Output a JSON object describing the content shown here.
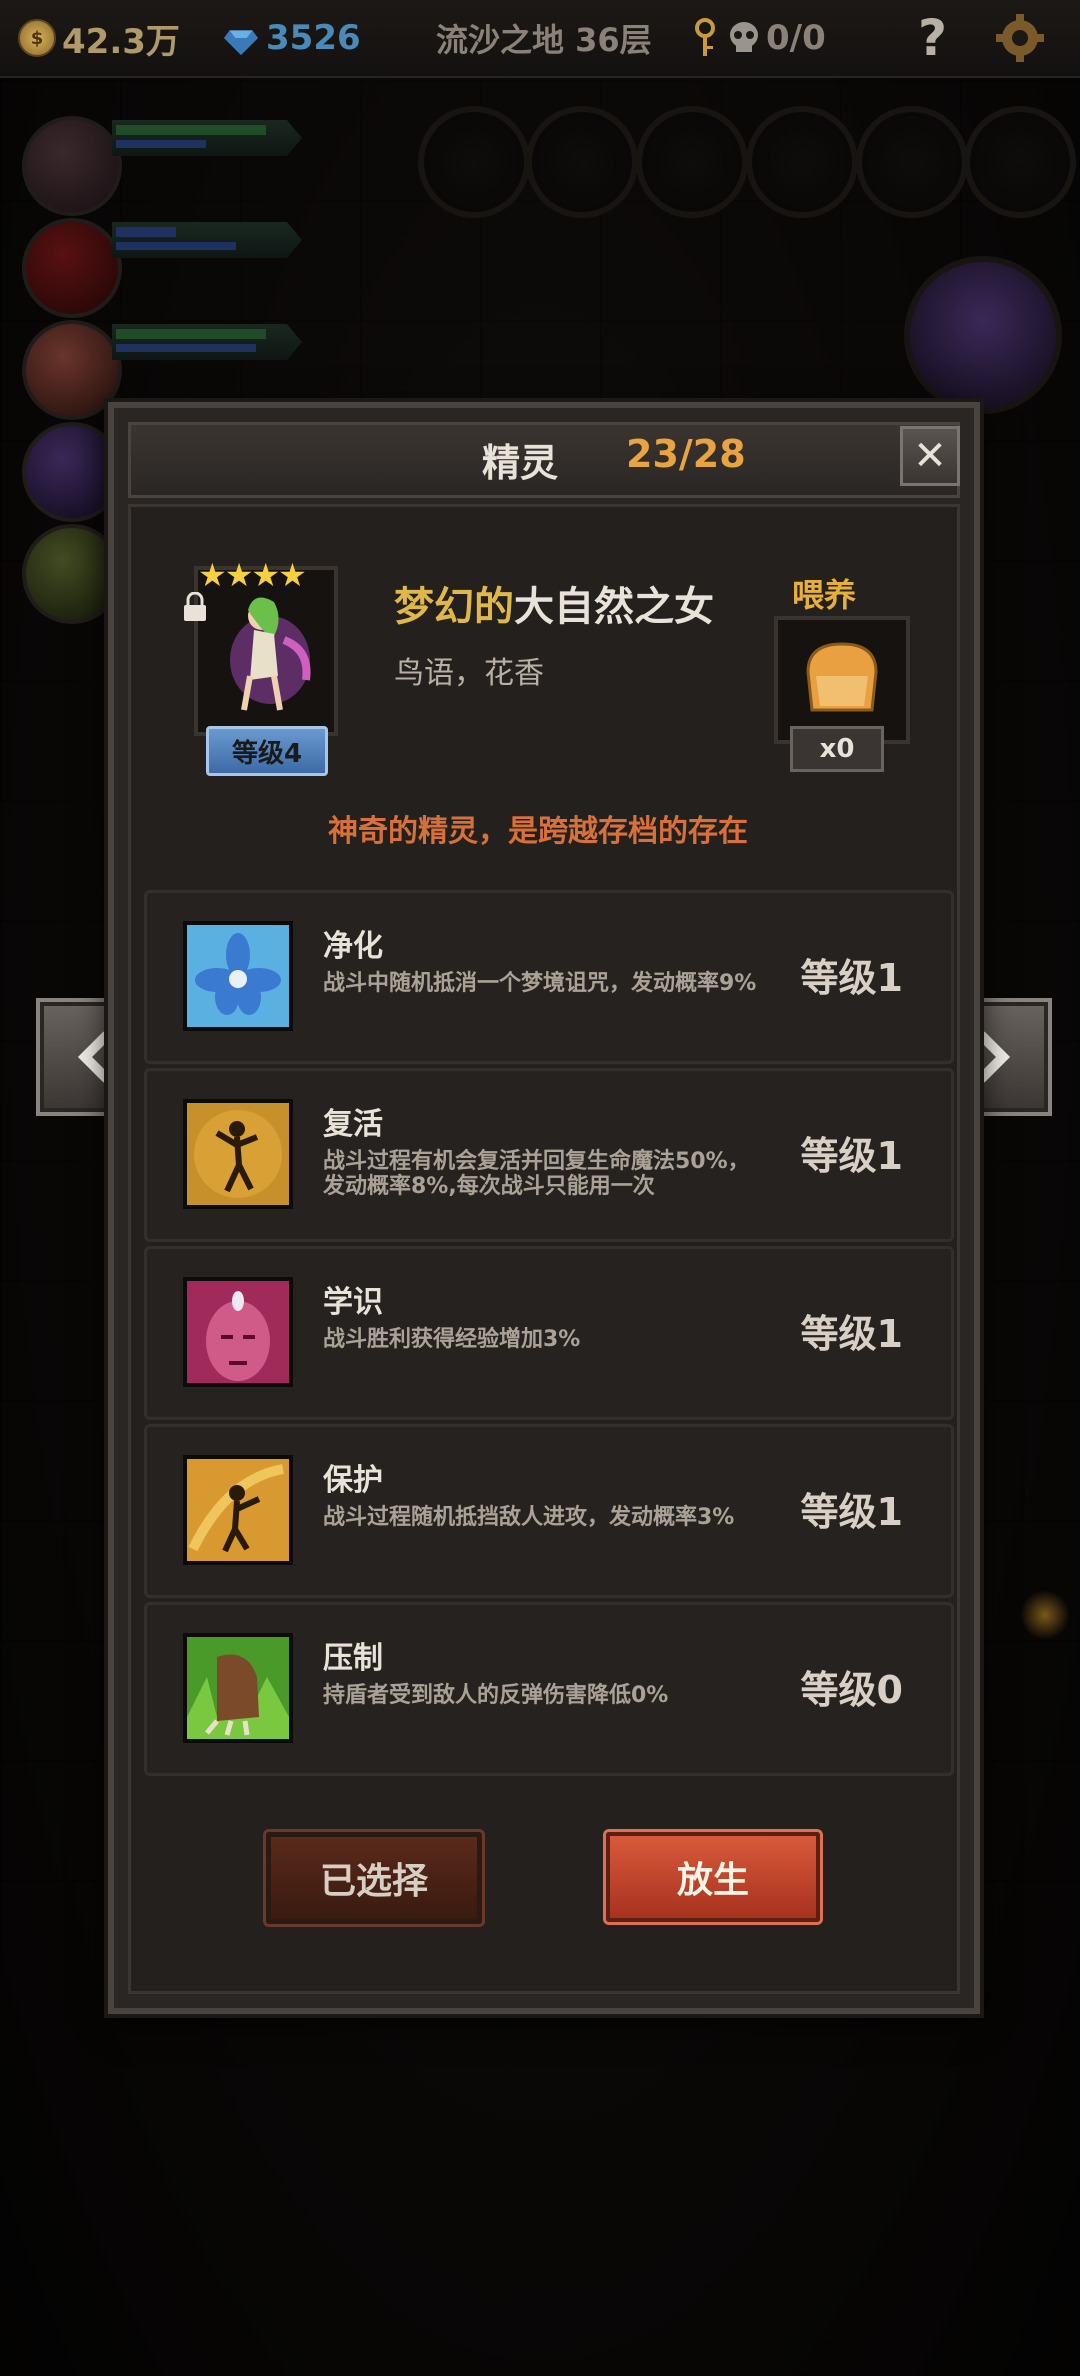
{
  "status_bar": {
    "gold": "42.3万",
    "gems": "3526",
    "location": "流沙之地 36层",
    "kills": "0/0",
    "help": "?"
  },
  "dialog": {
    "title": "精灵",
    "count": "23/28",
    "close": "✕"
  },
  "spirit": {
    "name_part1": "梦幻的",
    "name_part2": "大自然之女",
    "subtitle": "鸟语，花香",
    "stars": "★★★★",
    "level": "等级4",
    "feed_label": "喂养",
    "feed_count": "x0",
    "description": "神奇的精灵，是跨越存档的存在"
  },
  "skills": [
    {
      "name": "净化",
      "desc": "战斗中随机抵消一个梦境诅咒，发动概率9%",
      "level": "等级1",
      "icon": "blue-flower-icon"
    },
    {
      "name": "复活",
      "desc": "战斗过程有机会复活并回复生命魔法50%，发动概率8%,每次战斗只能用一次",
      "level": "等级1",
      "icon": "revive-figure-icon"
    },
    {
      "name": "学识",
      "desc": "战斗胜利获得经验增加3%",
      "level": "等级1",
      "icon": "sage-face-icon"
    },
    {
      "name": "保护",
      "desc": "战斗过程随机抵挡敌人进攻，发动概率3%",
      "level": "等级1",
      "icon": "protect-fairy-icon"
    },
    {
      "name": "压制",
      "desc": "持盾者受到敌人的反弹伤害降低0%",
      "level": "等级0",
      "icon": "beast-claw-icon"
    }
  ],
  "buttons": {
    "selected": "已选择",
    "release": "放生"
  },
  "colors": {
    "accent_orange": "#e8a440",
    "name_gold": "#e0b84a",
    "desc_orange": "#d8703a",
    "release_red": "#c8442a",
    "level_badge_blue": "#4a7ab5"
  }
}
